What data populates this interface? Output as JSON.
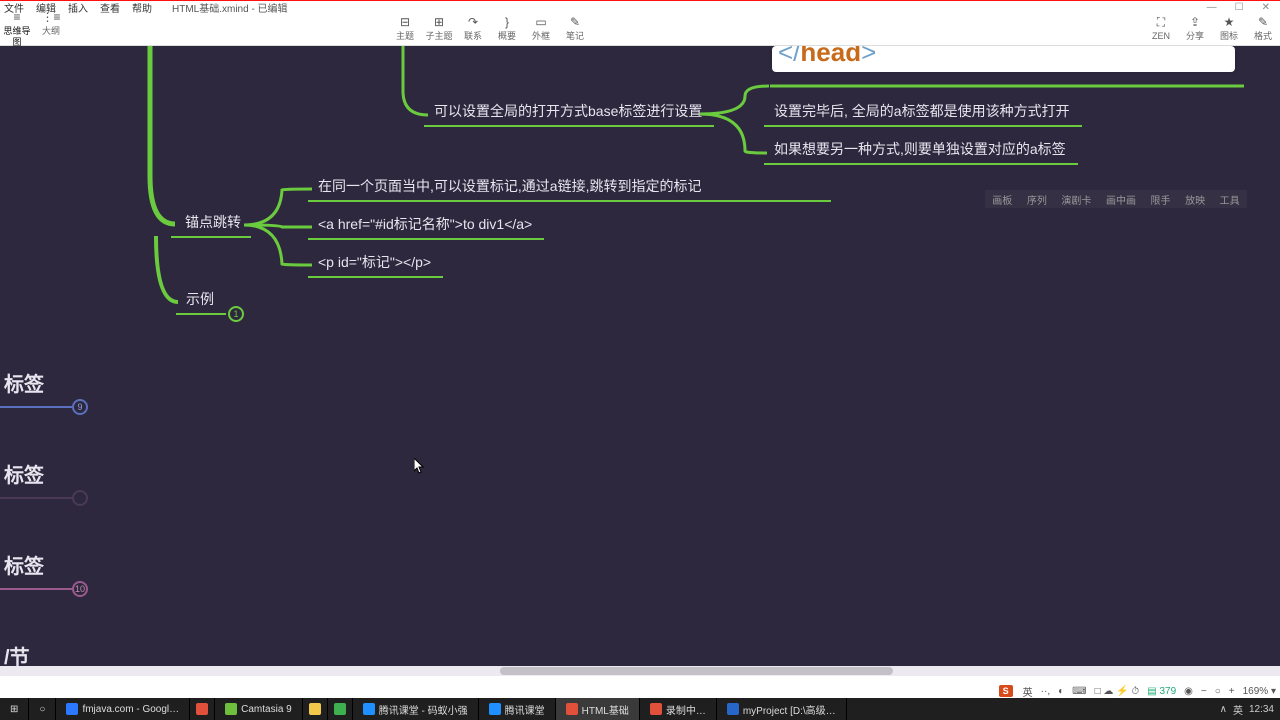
{
  "window": {
    "menus": [
      "文件",
      "编辑",
      "插入",
      "查看",
      "帮助"
    ],
    "title": "HTML基础.xmind - 已编辑",
    "controls": [
      "—",
      "☐",
      "✕"
    ]
  },
  "toolbar": {
    "left": [
      {
        "icon": "≡",
        "label": "思维导图"
      },
      {
        "icon": "⋮≡",
        "label": "大纲"
      }
    ],
    "mid": [
      {
        "icon": "⊟",
        "label": "主题"
      },
      {
        "icon": "⊞",
        "label": "子主题"
      },
      {
        "icon": "↷",
        "label": "联系"
      },
      {
        "icon": "}",
        "label": "概要"
      },
      {
        "icon": "▭",
        "label": "外框"
      },
      {
        "icon": "✎",
        "label": "笔记"
      }
    ],
    "right": [
      {
        "icon": "⛶",
        "label": "ZEN"
      },
      {
        "icon": "⇪",
        "label": "分享"
      },
      {
        "icon": "★",
        "label": "图标"
      },
      {
        "icon": "✎",
        "label": "格式"
      }
    ]
  },
  "mindmap": {
    "codebox_html": "</head>",
    "n_base": "可以设置全局的打开方式base标签进行设置",
    "n_base_c1": "设置完毕后, 全局的a标签都是使用该种方式打开",
    "n_base_c2": "如果想要另一种方式,则要单独设置对应的a标签",
    "n_anchor": "锚点跳转",
    "n_anchor_c1": "在同一个页面当中,可以设置标记,通过a链接,跳转到指定的标记",
    "n_anchor_c2": "<a href=\"#id标记名称\">to div1</a>",
    "n_anchor_c3": "<p id=\"标记\"></p>",
    "n_example": "示例",
    "labels": {
      "tag1": "标签",
      "tag2": "标签",
      "tag3": "标签",
      "sec": "/节"
    },
    "badges": {
      "ex": "1",
      "tag1": "9",
      "tag3": "10"
    }
  },
  "legend": [
    "画板",
    "序列",
    "演剧卡",
    "画中画",
    "限手",
    "放映",
    "工具"
  ],
  "status": {
    "ime": "S",
    "lang1": "英",
    "punc": "··,",
    "half": "◐",
    "kb": "⌨",
    "tray_icons": [
      "□",
      "☁",
      "⚡",
      "⏱"
    ],
    "count": "379",
    "eye": "◉",
    "minus": "−",
    "dot": "○",
    "plus": "+",
    "zoom": "169% ▾"
  },
  "taskbar": {
    "items": [
      {
        "label": "fmjava.com - Googl…",
        "color": "#2b79ff"
      },
      {
        "label": "",
        "color": "#e0503a",
        "narrow": true
      },
      {
        "label": "Camtasia 9",
        "color": "#6fbf3f"
      },
      {
        "label": "",
        "color": "#f2c84b",
        "narrow": true
      },
      {
        "label": "",
        "color": "#3fb04f",
        "narrow": true
      },
      {
        "label": "腾讯课堂 - 码蚁小强",
        "color": "#1e90ff"
      },
      {
        "label": "腾讯课堂",
        "color": "#1e90ff"
      },
      {
        "label": "HTML基础",
        "color": "#e0503a",
        "active": true
      },
      {
        "label": "录制中…",
        "color": "#e0503a"
      },
      {
        "label": "myProject [D:\\高级…",
        "color": "#2667c9"
      }
    ],
    "tray": [
      "∧",
      "英",
      "12:34"
    ]
  }
}
